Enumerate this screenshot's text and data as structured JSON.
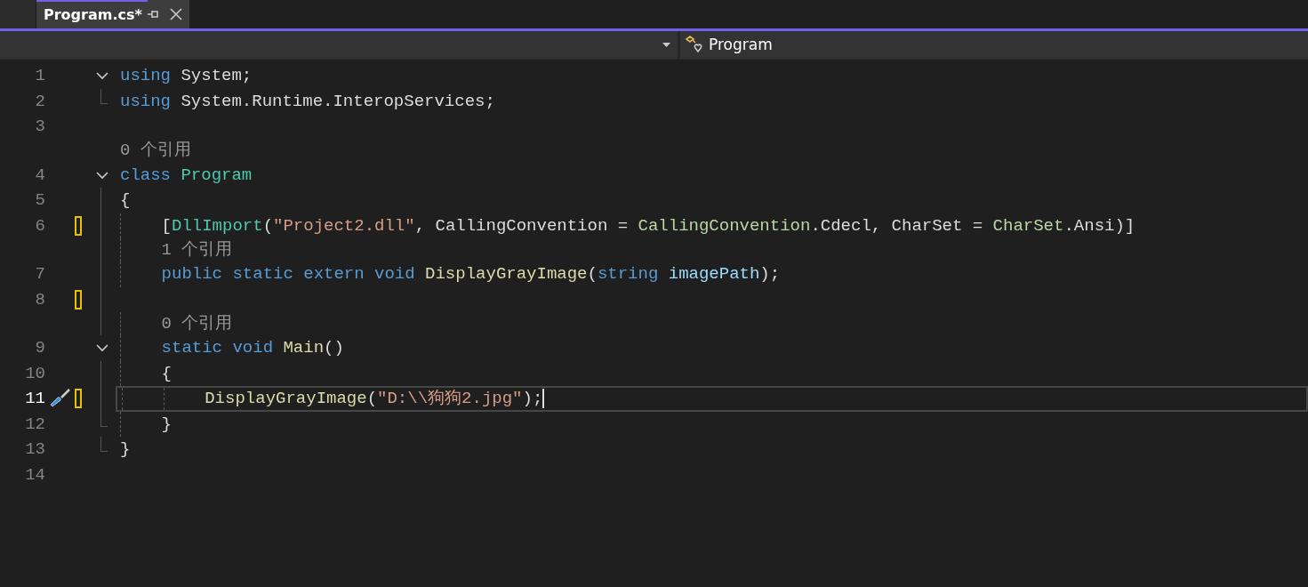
{
  "tabs": [
    {
      "label": "Program.cs*",
      "selected": true
    }
  ],
  "navigation": {
    "member": "Program"
  },
  "lines": [
    {
      "kind": "code",
      "number": "1",
      "expanded": true,
      "modified": false,
      "current": false,
      "tokens": [
        {
          "text": "using ",
          "kind": "keyword"
        },
        {
          "text": "System;",
          "kind": "plain"
        }
      ]
    },
    {
      "kind": "code",
      "number": "2",
      "region_end": true,
      "modified": false,
      "current": false,
      "tokens": [
        {
          "text": "using ",
          "kind": "keyword"
        },
        {
          "text": "System.Runtime.InteropServices;",
          "kind": "plain"
        }
      ]
    },
    {
      "kind": "code",
      "number": "3",
      "modified": false,
      "current": false
    },
    {
      "kind": "lens",
      "text": "0 个引用"
    },
    {
      "kind": "code",
      "number": "4",
      "expanded": true,
      "modified": false,
      "current": false,
      "tokens": [
        {
          "text": "class ",
          "kind": "keyword"
        },
        {
          "text": "Program",
          "kind": "type"
        }
      ]
    },
    {
      "kind": "code",
      "number": "5",
      "modified": false,
      "current": false,
      "tokens": [
        {
          "text": "{",
          "kind": "plain"
        }
      ]
    },
    {
      "kind": "code",
      "number": "6",
      "modified": true,
      "current": false,
      "tokens": [
        {
          "text": "    [",
          "kind": "plain"
        },
        {
          "text": "DllImport",
          "kind": "type"
        },
        {
          "text": "(",
          "kind": "plain"
        },
        {
          "text": "\"Project2.dll\"",
          "kind": "string"
        },
        {
          "text": ", CallingConvention = ",
          "kind": "plain"
        },
        {
          "text": "CallingConvention",
          "kind": "enum"
        },
        {
          "text": ".Cdecl, CharSet = ",
          "kind": "plain"
        },
        {
          "text": "CharSet",
          "kind": "enum"
        },
        {
          "text": ".Ansi)]",
          "kind": "plain"
        }
      ]
    },
    {
      "kind": "lens",
      "text": "    1 个引用"
    },
    {
      "kind": "code",
      "number": "7",
      "modified": false,
      "current": false,
      "tokens": [
        {
          "text": "    public static extern void ",
          "kind": "keyword"
        },
        {
          "text": "DisplayGrayImage",
          "kind": "method"
        },
        {
          "text": "(",
          "kind": "plain"
        },
        {
          "text": "string ",
          "kind": "keyword"
        },
        {
          "text": "imagePath",
          "kind": "param"
        },
        {
          "text": ");",
          "kind": "plain"
        }
      ]
    },
    {
      "kind": "code",
      "number": "8",
      "modified": true,
      "current": false
    },
    {
      "kind": "lens",
      "text": "    0 个引用"
    },
    {
      "kind": "code",
      "number": "9",
      "expanded": true,
      "modified": false,
      "current": false,
      "tokens": [
        {
          "text": "    static void ",
          "kind": "keyword"
        },
        {
          "text": "Main",
          "kind": "method"
        },
        {
          "text": "()",
          "kind": "plain"
        }
      ]
    },
    {
      "kind": "code",
      "number": "10",
      "modified": false,
      "current": false,
      "tokens": [
        {
          "text": "    {",
          "kind": "plain"
        }
      ]
    },
    {
      "kind": "code",
      "number": "11",
      "modified": true,
      "current": true,
      "tokens": [
        {
          "text": "        DisplayGrayImage",
          "kind": "method"
        },
        {
          "text": "(",
          "kind": "plain"
        },
        {
          "text": "\"D:\\\\狗狗2.jpg\"",
          "kind": "string"
        },
        {
          "text": ");",
          "kind": "plain"
        }
      ]
    },
    {
      "kind": "code",
      "number": "12",
      "region_end": true,
      "modified": false,
      "current": false,
      "tokens": [
        {
          "text": "    }",
          "kind": "plain"
        }
      ]
    },
    {
      "kind": "code",
      "number": "13",
      "region_end": true,
      "modified": false,
      "current": false,
      "tokens": [
        {
          "text": "}",
          "kind": "plain"
        }
      ]
    },
    {
      "kind": "code",
      "number": "14",
      "modified": false,
      "current": false
    }
  ]
}
